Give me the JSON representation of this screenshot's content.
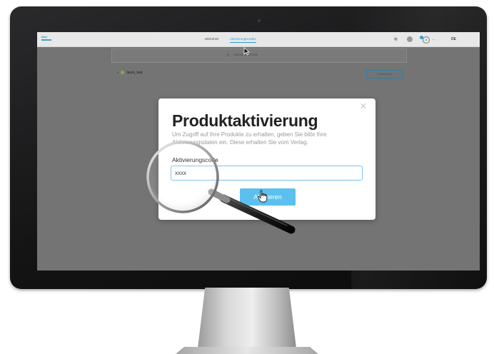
{
  "app": {
    "logo_text": "diwi",
    "nav": [
      "Bibliothek",
      "Aktivierungscodes"
    ],
    "active_nav": "Aktivierungscodes",
    "language": "DE",
    "user_initial": "A",
    "accent_color": "#2e9fd4"
  },
  "product_list": {
    "add_label": "Aktivierungscode",
    "items": [
      {
        "name": "laura_test",
        "status_color": "#7cb342",
        "action_label": "Deaktivieren"
      }
    ]
  },
  "modal": {
    "title": "Produktaktivierung",
    "description": "Um Zugriff auf Ihre Produkte zu erhalten, geben Sie bitte Ihre Aktivierungsdaten ein. Diese erhalten Sie vom Verlag.",
    "field_label": "Aktivierungscode",
    "field_value": "xxxx",
    "submit_label": "Aktivieren",
    "close_icon": "close-icon",
    "button_color": "#5bc0ee"
  },
  "icons": [
    "device-icon",
    "settings-icon",
    "user-icon",
    "chevron-down-icon",
    "plus-icon",
    "chevron-right-icon",
    "magnifier-icon",
    "hand-cursor-icon",
    "pointer-cursor-icon"
  ]
}
